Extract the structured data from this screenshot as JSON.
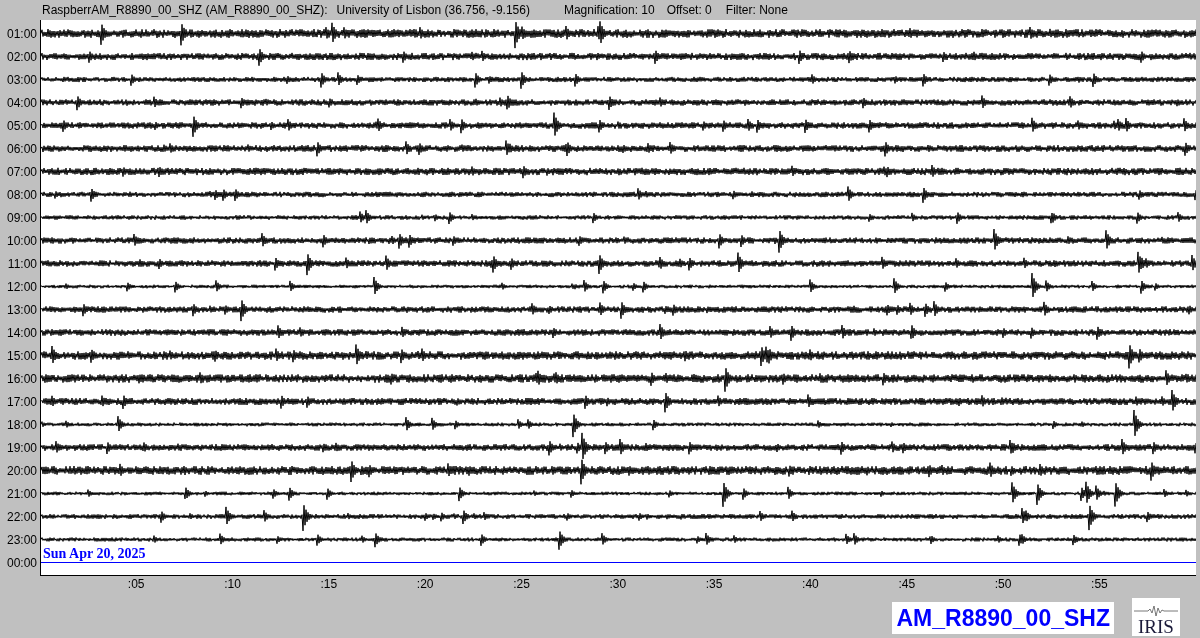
{
  "header": {
    "station": "RaspberrAM_R8890_00_SHZ (AM_R8890_00_SHZ):",
    "location": "University of Lisbon (36.756, -9.156)",
    "magnification": "Magnification: 10",
    "offset": "Offset: 0",
    "filter": "Filter: None"
  },
  "helicorder": {
    "hour_labels": [
      "01:00",
      "02:00",
      "03:00",
      "04:00",
      "05:00",
      "06:00",
      "07:00",
      "08:00",
      "09:00",
      "10:00",
      "11:00",
      "12:00",
      "13:00",
      "14:00",
      "15:00",
      "16:00",
      "17:00",
      "18:00",
      "19:00",
      "20:00",
      "21:00",
      "22:00",
      "23:00",
      "00:00"
    ],
    "date": "Sun Apr 20, 2025",
    "minute_labels": [
      ":05",
      ":10",
      ":15",
      ":20",
      ":25",
      ":30",
      ":35",
      ":40",
      ":45",
      ":50",
      ":55"
    ]
  },
  "station_badge": "AM_R8890_00_SHZ",
  "logo": "IRIS"
}
